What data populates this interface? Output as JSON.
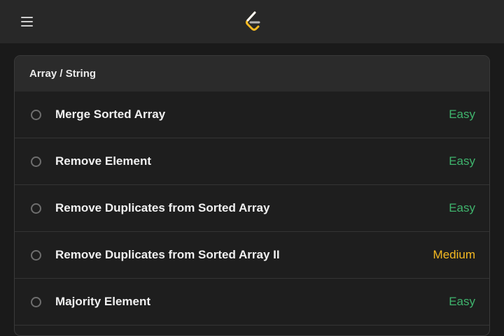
{
  "topbar": {
    "menu_icon": "hamburger-menu-icon",
    "logo_icon": "leetcode-logo-icon"
  },
  "colors": {
    "easy": "#3fb46d",
    "medium": "#f5b921",
    "background": "#1a1a1a",
    "topbar": "#282828"
  },
  "section": {
    "title": "Array / String",
    "problems": [
      {
        "title": "Merge Sorted Array",
        "difficulty": "Easy",
        "level": "easy"
      },
      {
        "title": "Remove Element",
        "difficulty": "Easy",
        "level": "easy"
      },
      {
        "title": "Remove Duplicates from Sorted Array",
        "difficulty": "Easy",
        "level": "easy"
      },
      {
        "title": "Remove Duplicates from Sorted Array II",
        "difficulty": "Medium",
        "level": "medium"
      },
      {
        "title": "Majority Element",
        "difficulty": "Easy",
        "level": "easy"
      }
    ]
  }
}
